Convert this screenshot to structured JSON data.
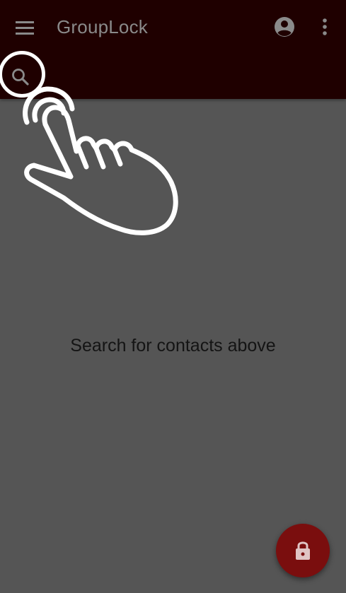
{
  "app_bar": {
    "title": "GroupLock",
    "menu_icon": "hamburger-menu-icon",
    "account_icon": "account-circle-icon",
    "more_icon": "more-vert-icon",
    "search_icon": "search-icon"
  },
  "main": {
    "empty_message": "Search for contacts above"
  },
  "fab": {
    "icon": "lock-icon"
  },
  "colors": {
    "app_bar": "#1f0000",
    "background": "#555555",
    "fab": "#7a0e0e",
    "overlay_white": "#ffffff"
  }
}
